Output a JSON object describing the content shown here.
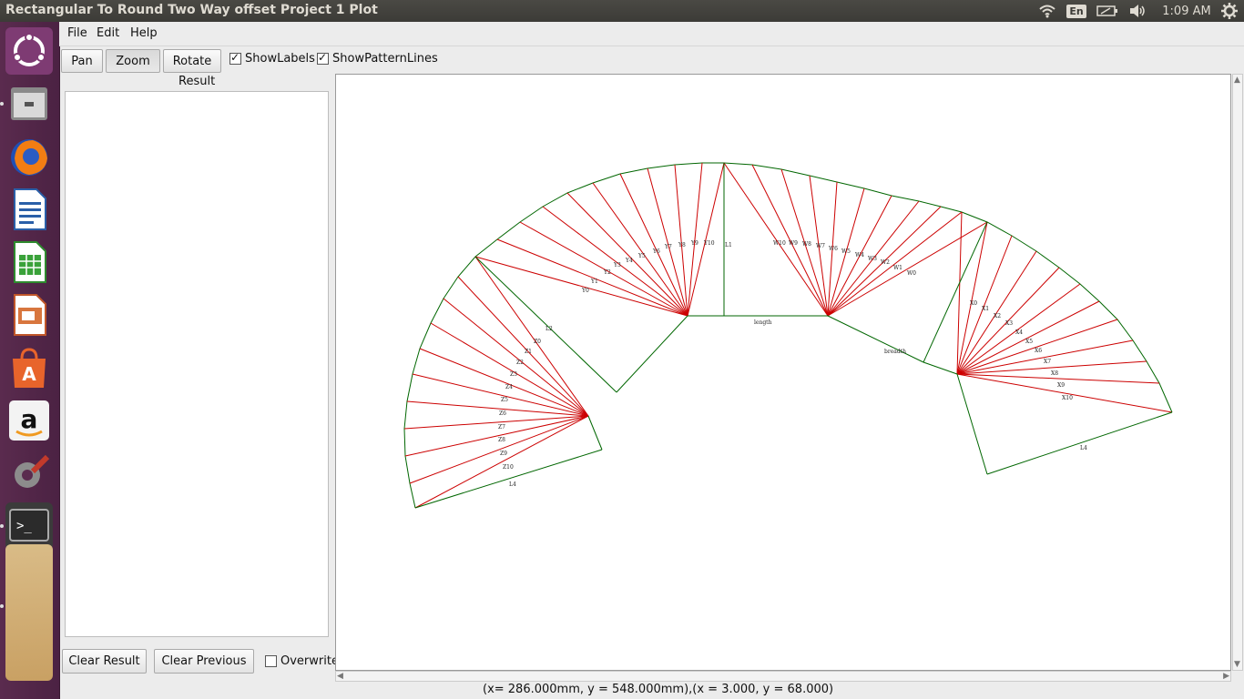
{
  "window": {
    "title": "Rectangular To Round Two Way offset Project 1 Plot"
  },
  "tray": {
    "lang": "En",
    "clock": "1:09 AM"
  },
  "launcher": {
    "items": [
      {
        "name": "ubuntu-dash-icon"
      },
      {
        "name": "files-icon"
      },
      {
        "name": "firefox-icon"
      },
      {
        "name": "writer-icon"
      },
      {
        "name": "calc-icon"
      },
      {
        "name": "impress-icon"
      },
      {
        "name": "software-center-icon"
      },
      {
        "name": "amazon-icon"
      },
      {
        "name": "system-settings-icon"
      },
      {
        "name": "terminal-icon"
      }
    ]
  },
  "menu": {
    "file": "File",
    "edit": "Edit",
    "help": "Help"
  },
  "toolbar": {
    "pan": "Pan",
    "zoom": "Zoom",
    "rotate": "Rotate",
    "show_labels": "ShowLabels",
    "show_pattern_lines": "ShowPatternLines",
    "show_labels_checked": true,
    "show_pattern_lines_checked": true
  },
  "result": {
    "label": "Result"
  },
  "bottom": {
    "clear_result": "Clear Result",
    "clear_previous": "Clear Previous",
    "overwrite": "Overwrite"
  },
  "status": {
    "text": "(x= 286.000mm, y = 548.000mm),(x = 3.000, y = 68.000)"
  },
  "plot": {
    "colors": {
      "outline": "#006600",
      "pattern": "#cc0000"
    },
    "labels": {
      "L1": "L1",
      "L2": "L2",
      "L4": "L4",
      "L4b": "L4",
      "length": "length",
      "breadth": "breadth",
      "Y": [
        "Y0",
        "Y1",
        "Y2",
        "Y3",
        "Y4",
        "Y5",
        "Y6",
        "Y7",
        "Y8",
        "Y9",
        "Y10"
      ],
      "W": [
        "W0",
        "W1",
        "W2",
        "W3",
        "W4",
        "W5",
        "W6",
        "W7",
        "W8",
        "W9",
        "W10"
      ],
      "Z": [
        "Z0",
        "Z1",
        "Z2",
        "Z3",
        "Z4",
        "Z5",
        "Z6",
        "Z7",
        "Z8",
        "Z9",
        "Z10"
      ],
      "X": [
        "X0",
        "X1",
        "X2",
        "X3",
        "X4",
        "X5",
        "X6",
        "X7",
        "X8",
        "X9",
        "X10"
      ]
    }
  },
  "icons": {
    "wifi": "wifi-icon",
    "battery": "battery-icon",
    "volume": "volume-icon",
    "gear": "gear-icon"
  }
}
